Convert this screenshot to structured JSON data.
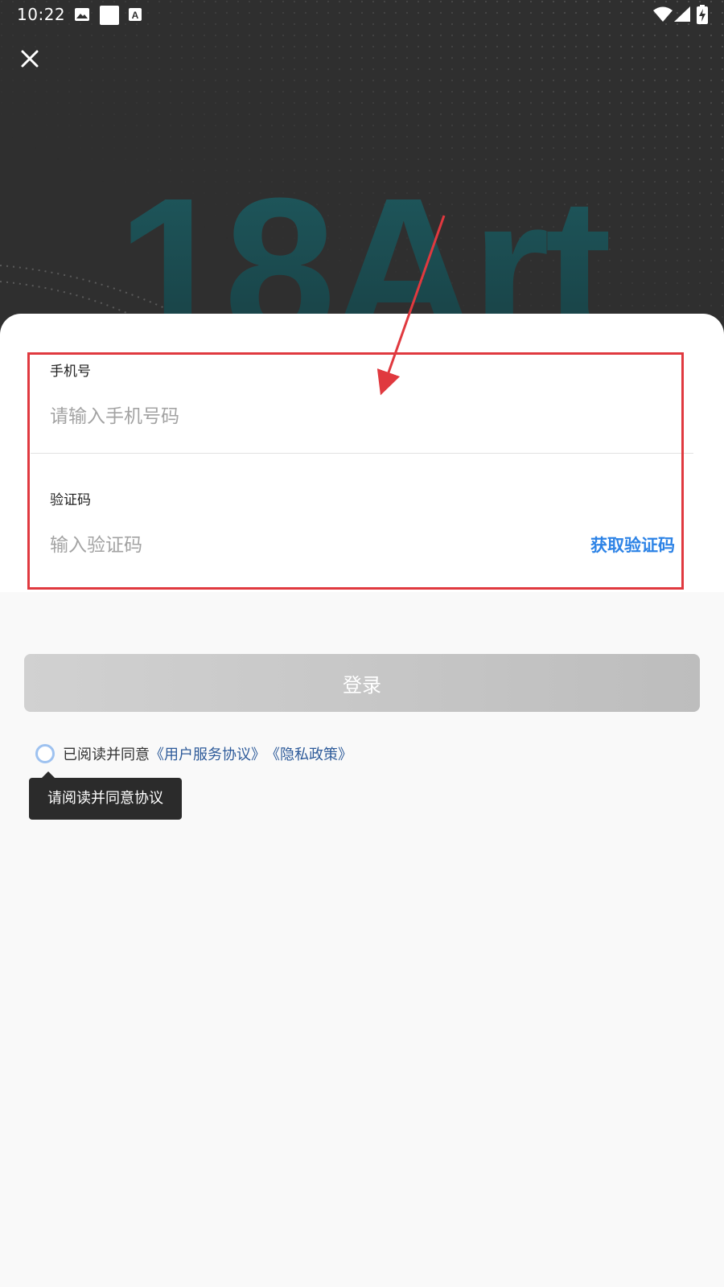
{
  "status_bar": {
    "time": "10:22",
    "icons": [
      "image-icon",
      "white-square-icon",
      "a-notification-icon",
      "wifi-icon",
      "signal-icon",
      "battery-charging-icon"
    ]
  },
  "hero": {
    "brand_text": "18Art",
    "close_icon": "close-icon"
  },
  "form": {
    "phone": {
      "label": "手机号",
      "placeholder": "请输入手机号码",
      "value": ""
    },
    "code": {
      "label": "验证码",
      "placeholder": "输入验证码",
      "value": "",
      "get_code_label": "获取验证码"
    }
  },
  "login_button": {
    "label": "登录"
  },
  "agreement": {
    "prefix": "已阅读并同意",
    "terms_link": "《用户服务协议》",
    "privacy_link": "《隐私政策》",
    "tooltip": "请阅读并同意协议"
  },
  "colors": {
    "hero_bg": "#2f2f2f",
    "brand_text": "#1f5156",
    "link_blue": "#2d83e6",
    "annotation_red": "#e0393f",
    "page_bg": "#f9f9f9"
  }
}
